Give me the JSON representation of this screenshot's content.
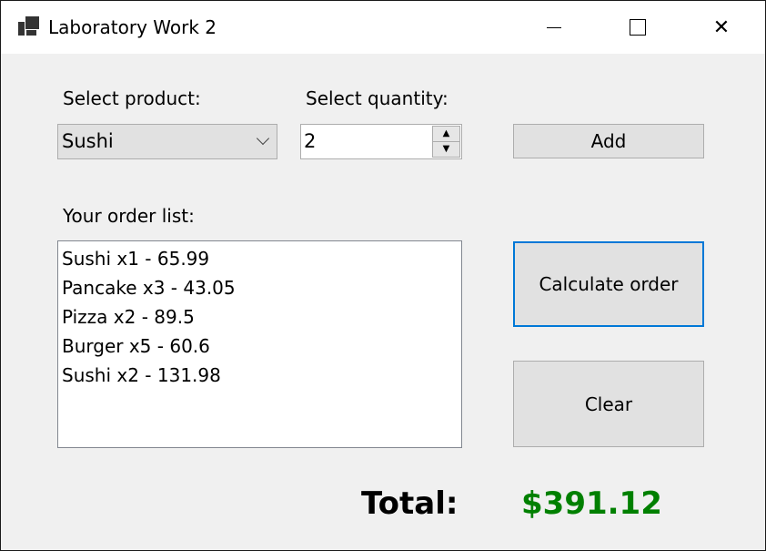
{
  "window": {
    "title": "Laboratory Work 2",
    "icon": "app-window-icon"
  },
  "form": {
    "product_label": "Select product:",
    "product_value": "Sushi",
    "quantity_label": "Select quantity:",
    "quantity_value": "2",
    "add_label": "Add",
    "order_label": "Your order list:",
    "order_items": [
      "Sushi x1 - 65.99",
      "Pancake x3 - 43.05",
      "Pizza x2 - 89.5",
      "Burger x5 - 60.6",
      "Sushi x2 - 131.98"
    ],
    "calculate_label": "Calculate order",
    "clear_label": "Clear",
    "total_label": "Total:",
    "total_value": "$391.12",
    "total_color": "#008000"
  }
}
